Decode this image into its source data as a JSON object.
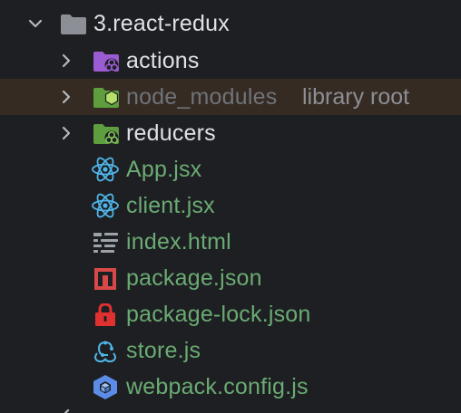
{
  "project_tree": {
    "root": {
      "label": "3.react-redux",
      "expanded": true,
      "icon": "folder-icon"
    },
    "items": [
      {
        "label": "actions",
        "kind": "folder",
        "icon": "redux-folder-icon",
        "expanded": false
      },
      {
        "label": "node_modules",
        "suffix": "library root",
        "kind": "folder",
        "icon": "node-modules-folder-icon",
        "expanded": false,
        "highlighted": true
      },
      {
        "label": "reducers",
        "kind": "folder",
        "icon": "redux-folder-icon",
        "expanded": false
      },
      {
        "label": "App.jsx",
        "kind": "file",
        "icon": "react-icon"
      },
      {
        "label": "client.jsx",
        "kind": "file",
        "icon": "react-icon"
      },
      {
        "label": "index.html",
        "kind": "file",
        "icon": "html-icon"
      },
      {
        "label": "package.json",
        "kind": "file",
        "icon": "npm-icon"
      },
      {
        "label": "package-lock.json",
        "kind": "file",
        "icon": "lock-icon"
      },
      {
        "label": "store.js",
        "kind": "file",
        "icon": "redux-icon"
      },
      {
        "label": "webpack.config.js",
        "kind": "file",
        "icon": "webpack-icon"
      }
    ]
  },
  "colors": {
    "background": "#1e1f22",
    "highlight_row": "#352b23",
    "folder_text": "#dfe1e5",
    "file_text": "#6aab73",
    "ignored_text": "#6f737a",
    "suffix_text": "#8c8f95",
    "folder_gray": "#8c9096",
    "redux_purple": "#9b5bd3",
    "node_green": "#5e9e3e",
    "react_blue": "#4fb5e8",
    "npm_red": "#d94848",
    "lock_red": "#e03131",
    "webpack_blue": "#5b8de8"
  }
}
